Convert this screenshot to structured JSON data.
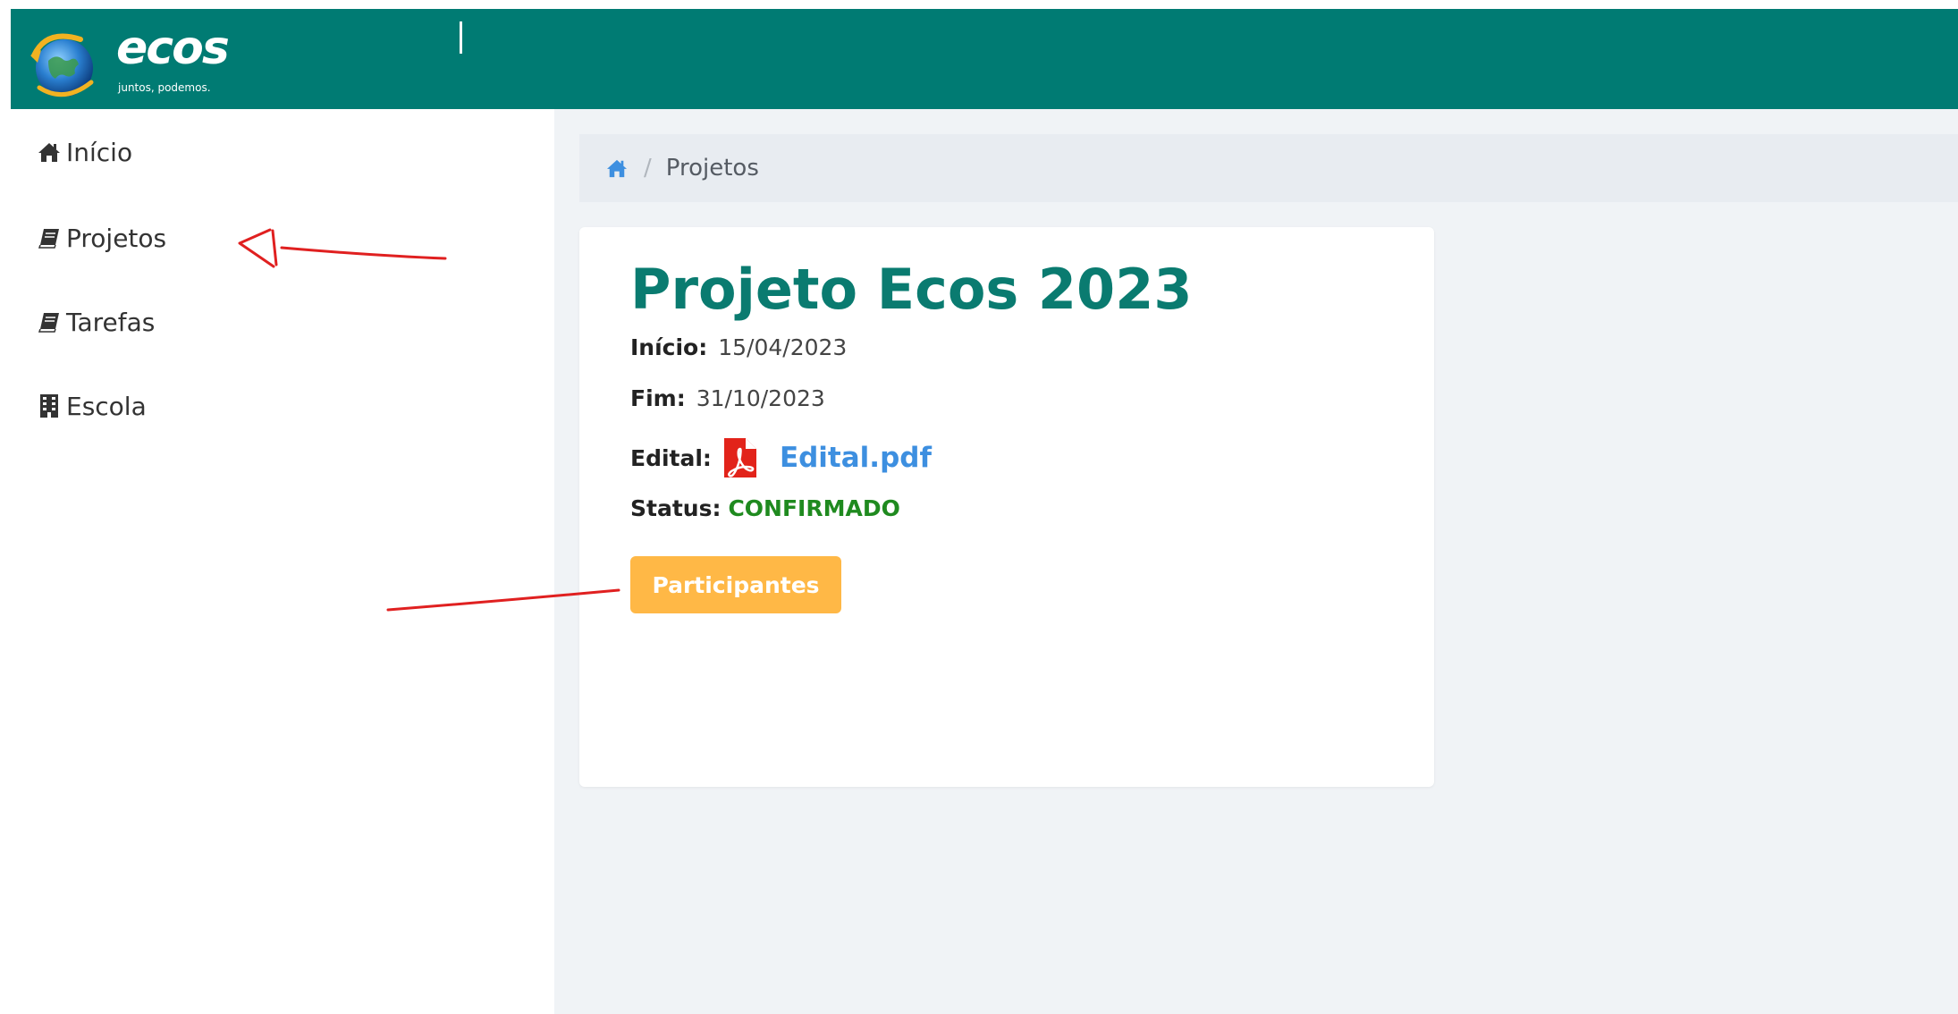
{
  "header": {
    "logo_text": "ecos",
    "logo_tagline": "juntos, podemos."
  },
  "sidebar": {
    "items": [
      {
        "label": "Início",
        "icon": "home-icon"
      },
      {
        "label": "Projetos",
        "icon": "book-icon"
      },
      {
        "label": "Tarefas",
        "icon": "book-icon"
      },
      {
        "label": "Escola",
        "icon": "building-icon"
      }
    ]
  },
  "breadcrumb": {
    "home_icon": "home-icon",
    "current": "Projetos",
    "separator": "/"
  },
  "project": {
    "title": "Projeto Ecos 2023",
    "start_label": "Início:",
    "start_value": "15/04/2023",
    "end_label": "Fim:",
    "end_value": "31/10/2023",
    "edital_label": "Edital:",
    "edital_icon": "pdf-icon",
    "edital_link": "Edital.pdf",
    "status_label": "Status:",
    "status_value": "CONFIRMADO",
    "participants_button": "Participantes"
  },
  "colors": {
    "header_bg": "#007b73",
    "title": "#0a7b70",
    "link": "#3d8fe0",
    "status": "#1f8a1f",
    "button": "#ffb846",
    "annotation": "#e02020"
  }
}
